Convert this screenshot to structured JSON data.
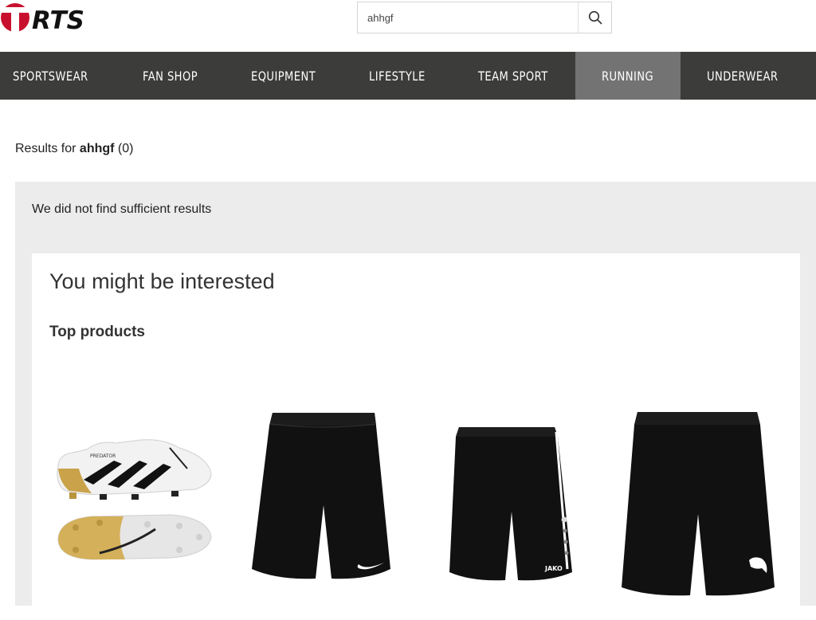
{
  "brand": {
    "logo_text": "RTS"
  },
  "search": {
    "query": "ahhgf",
    "placeholder": ""
  },
  "nav": {
    "items": [
      {
        "label": "SPORTSWEAR"
      },
      {
        "label": "FAN SHOP"
      },
      {
        "label": "EQUIPMENT"
      },
      {
        "label": "LIFESTYLE"
      },
      {
        "label": "TEAM SPORT"
      },
      {
        "label": "RUNNING",
        "active": true
      },
      {
        "label": "UNDERWEAR"
      }
    ]
  },
  "results": {
    "prefix": "Results for",
    "query": "ahhgf",
    "count": "(0)"
  },
  "notice": "We did not find sufficient results",
  "suggestions": {
    "title": "You might be interested",
    "subtitle": "Top products",
    "products": [
      {
        "icon": "football-boots-image",
        "brand_text": "PREDATOR"
      },
      {
        "icon": "shorts-nike-image"
      },
      {
        "icon": "shorts-jako-image",
        "brand_text": "JAKO"
      },
      {
        "icon": "shorts-puma-image"
      }
    ]
  },
  "colors": {
    "nav_bg": "#3c3c3a",
    "nav_active": "#737373",
    "brand_red": "#c8102e",
    "panel_bg": "#ececec"
  }
}
